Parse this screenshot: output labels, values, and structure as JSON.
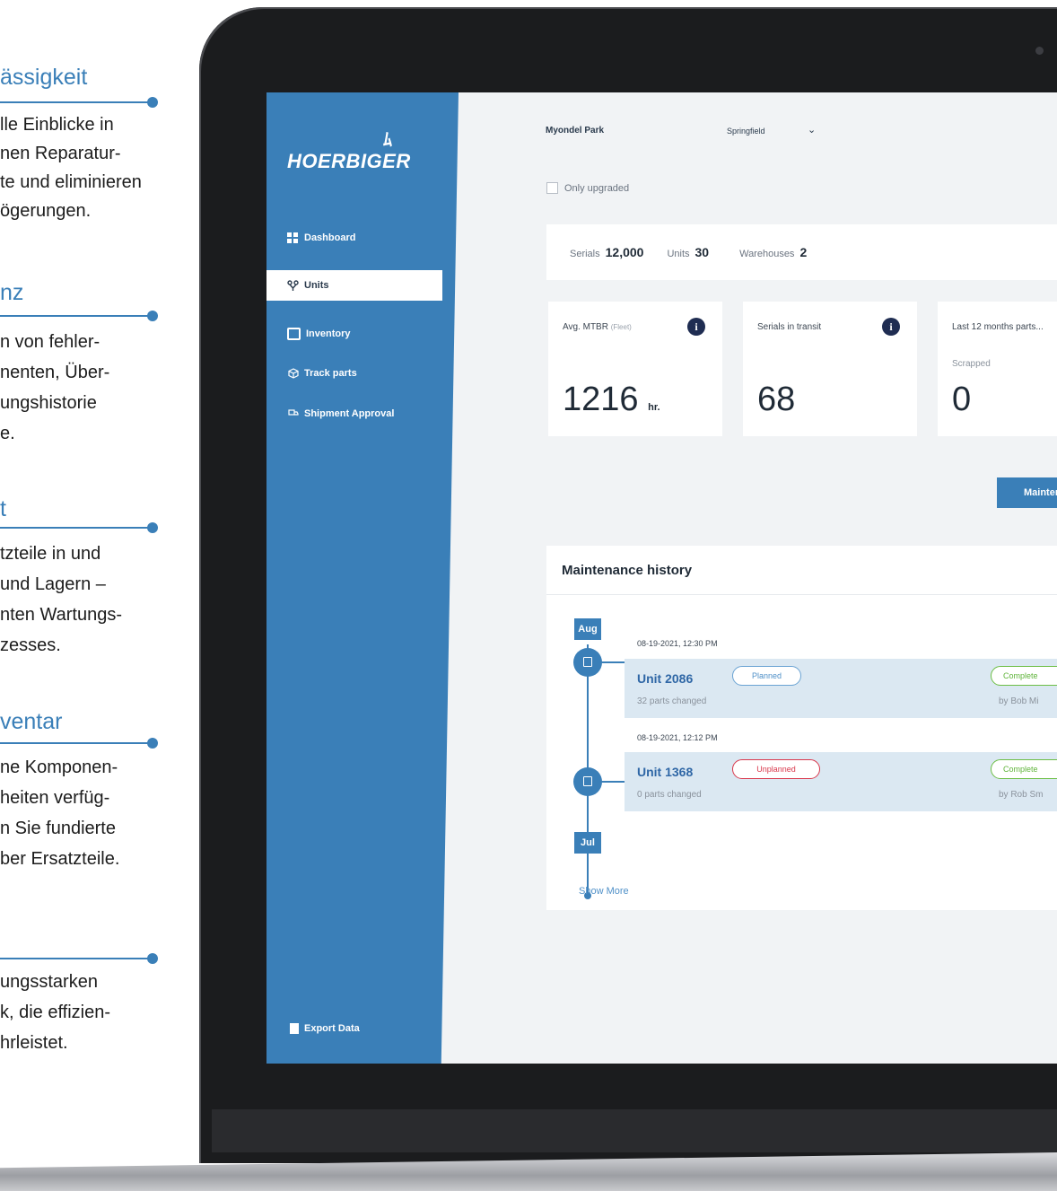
{
  "colors": {
    "accent": "#3a7fb8",
    "screen_bg": "#f1f3f5",
    "complete": "#6cbe45",
    "unplanned": "#d9374b"
  },
  "marketing": {
    "blocks": [
      {
        "heading": "ässigkeit",
        "lines": [
          "lle Einblicke in",
          "nen Reparatur-",
          "te und eliminieren",
          "ögerungen."
        ]
      },
      {
        "heading": "nz",
        "lines": [
          "n von fehler-",
          "nenten, Über-",
          "ungshistorie",
          "e."
        ]
      },
      {
        "heading": "t",
        "lines": [
          "tzteile in und",
          "und Lagern –",
          "nten Wartungs-",
          "zesses."
        ]
      },
      {
        "heading": "ventar",
        "lines": [
          "ne Komponen-",
          "heiten verfüg-",
          "n Sie fundierte",
          "ber Ersatzteile."
        ]
      },
      {
        "heading": "",
        "lines": [
          "ungsstarken",
          "k, die effizien-",
          "hrleistet."
        ]
      }
    ]
  },
  "sidebar": {
    "logo_mark": "ﾑ",
    "logo": "HOERBIGER",
    "items": [
      {
        "label": "Dashboard",
        "icon": "grid-icon"
      },
      {
        "label": "Units",
        "icon": "branch-icon"
      },
      {
        "label": "Inventory",
        "icon": "clipboard-icon"
      },
      {
        "label": "Track parts",
        "icon": "box-icon"
      },
      {
        "label": "Shipment Approval",
        "icon": "truck-icon"
      }
    ],
    "active": "Units",
    "export_label": "Export Data"
  },
  "filters": {
    "site_label": "Myondel Park",
    "city_value": "Springfield",
    "only_upgraded_label": "Only upgraded"
  },
  "stats": {
    "serials_label": "Serials",
    "serials_value": "12,000",
    "units_label": "Units",
    "units_value": "30",
    "warehouses_label": "Warehouses",
    "warehouses_value": "2"
  },
  "cards": [
    {
      "label": "Avg. MTBR",
      "label_small": "(Fleet)",
      "value": "1216",
      "unit": "hr."
    },
    {
      "label": "Serials in transit",
      "value": "68"
    },
    {
      "label": "Last 12 months parts...",
      "sub": "Scrapped",
      "value": "0"
    }
  ],
  "maintenance_button": "Maintenance",
  "history": {
    "title": "Maintenance history",
    "months": [
      "Aug",
      "Jul"
    ],
    "events": [
      {
        "date": "08-19-2021, 12:30 PM",
        "unit": "Unit 2086",
        "type": "Planned",
        "parts": "32 parts changed",
        "status": "Complete",
        "by": "by Bob Mi"
      },
      {
        "date": "08-19-2021, 12:12 PM",
        "unit": "Unit 1368",
        "type": "Unplanned",
        "parts": "0 parts changed",
        "status": "Complete",
        "by": "by Rob Sm"
      }
    ],
    "show_more": "Show More"
  }
}
